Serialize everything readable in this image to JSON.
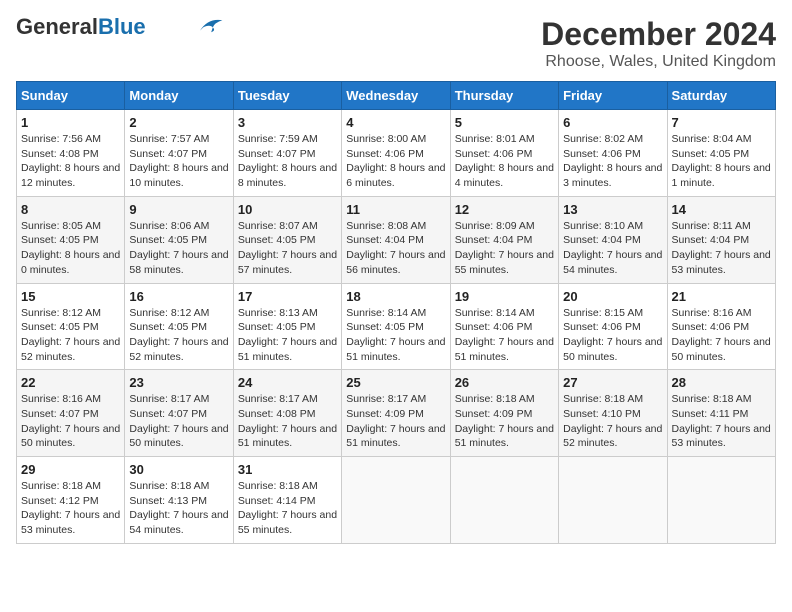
{
  "header": {
    "logo_general": "General",
    "logo_blue": "Blue",
    "title": "December 2024",
    "subtitle": "Rhoose, Wales, United Kingdom"
  },
  "calendar": {
    "days_of_week": [
      "Sunday",
      "Monday",
      "Tuesday",
      "Wednesday",
      "Thursday",
      "Friday",
      "Saturday"
    ],
    "weeks": [
      [
        null,
        {
          "day": "2",
          "sunrise": "7:57 AM",
          "sunset": "4:07 PM",
          "daylight": "8 hours and 10 minutes."
        },
        {
          "day": "3",
          "sunrise": "7:59 AM",
          "sunset": "4:07 PM",
          "daylight": "8 hours and 8 minutes."
        },
        {
          "day": "4",
          "sunrise": "8:00 AM",
          "sunset": "4:06 PM",
          "daylight": "8 hours and 6 minutes."
        },
        {
          "day": "5",
          "sunrise": "8:01 AM",
          "sunset": "4:06 PM",
          "daylight": "8 hours and 4 minutes."
        },
        {
          "day": "6",
          "sunrise": "8:02 AM",
          "sunset": "4:06 PM",
          "daylight": "8 hours and 3 minutes."
        },
        {
          "day": "7",
          "sunrise": "8:04 AM",
          "sunset": "4:05 PM",
          "daylight": "8 hours and 1 minute."
        }
      ],
      [
        {
          "day": "1",
          "sunrise": "7:56 AM",
          "sunset": "4:08 PM",
          "daylight": "8 hours and 12 minutes."
        },
        {
          "day": "9",
          "sunrise": "8:06 AM",
          "sunset": "4:05 PM",
          "daylight": "7 hours and 58 minutes."
        },
        {
          "day": "10",
          "sunrise": "8:07 AM",
          "sunset": "4:05 PM",
          "daylight": "7 hours and 57 minutes."
        },
        {
          "day": "11",
          "sunrise": "8:08 AM",
          "sunset": "4:04 PM",
          "daylight": "7 hours and 56 minutes."
        },
        {
          "day": "12",
          "sunrise": "8:09 AM",
          "sunset": "4:04 PM",
          "daylight": "7 hours and 55 minutes."
        },
        {
          "day": "13",
          "sunrise": "8:10 AM",
          "sunset": "4:04 PM",
          "daylight": "7 hours and 54 minutes."
        },
        {
          "day": "14",
          "sunrise": "8:11 AM",
          "sunset": "4:04 PM",
          "daylight": "7 hours and 53 minutes."
        }
      ],
      [
        {
          "day": "8",
          "sunrise": "8:05 AM",
          "sunset": "4:05 PM",
          "daylight": "8 hours and 0 minutes."
        },
        {
          "day": "16",
          "sunrise": "8:12 AM",
          "sunset": "4:05 PM",
          "daylight": "7 hours and 52 minutes."
        },
        {
          "day": "17",
          "sunrise": "8:13 AM",
          "sunset": "4:05 PM",
          "daylight": "7 hours and 51 minutes."
        },
        {
          "day": "18",
          "sunrise": "8:14 AM",
          "sunset": "4:05 PM",
          "daylight": "7 hours and 51 minutes."
        },
        {
          "day": "19",
          "sunrise": "8:14 AM",
          "sunset": "4:06 PM",
          "daylight": "7 hours and 51 minutes."
        },
        {
          "day": "20",
          "sunrise": "8:15 AM",
          "sunset": "4:06 PM",
          "daylight": "7 hours and 50 minutes."
        },
        {
          "day": "21",
          "sunrise": "8:16 AM",
          "sunset": "4:06 PM",
          "daylight": "7 hours and 50 minutes."
        }
      ],
      [
        {
          "day": "15",
          "sunrise": "8:12 AM",
          "sunset": "4:05 PM",
          "daylight": "7 hours and 52 minutes."
        },
        {
          "day": "23",
          "sunrise": "8:17 AM",
          "sunset": "4:07 PM",
          "daylight": "7 hours and 50 minutes."
        },
        {
          "day": "24",
          "sunrise": "8:17 AM",
          "sunset": "4:08 PM",
          "daylight": "7 hours and 51 minutes."
        },
        {
          "day": "25",
          "sunrise": "8:17 AM",
          "sunset": "4:09 PM",
          "daylight": "7 hours and 51 minutes."
        },
        {
          "day": "26",
          "sunrise": "8:18 AM",
          "sunset": "4:09 PM",
          "daylight": "7 hours and 51 minutes."
        },
        {
          "day": "27",
          "sunrise": "8:18 AM",
          "sunset": "4:10 PM",
          "daylight": "7 hours and 52 minutes."
        },
        {
          "day": "28",
          "sunrise": "8:18 AM",
          "sunset": "4:11 PM",
          "daylight": "7 hours and 53 minutes."
        }
      ],
      [
        {
          "day": "22",
          "sunrise": "8:16 AM",
          "sunset": "4:07 PM",
          "daylight": "7 hours and 50 minutes."
        },
        {
          "day": "30",
          "sunrise": "8:18 AM",
          "sunset": "4:13 PM",
          "daylight": "7 hours and 54 minutes."
        },
        {
          "day": "31",
          "sunrise": "8:18 AM",
          "sunset": "4:14 PM",
          "daylight": "7 hours and 55 minutes."
        },
        null,
        null,
        null,
        null
      ],
      [
        {
          "day": "29",
          "sunrise": "8:18 AM",
          "sunset": "4:12 PM",
          "daylight": "7 hours and 53 minutes."
        },
        null,
        null,
        null,
        null,
        null,
        null
      ]
    ]
  }
}
